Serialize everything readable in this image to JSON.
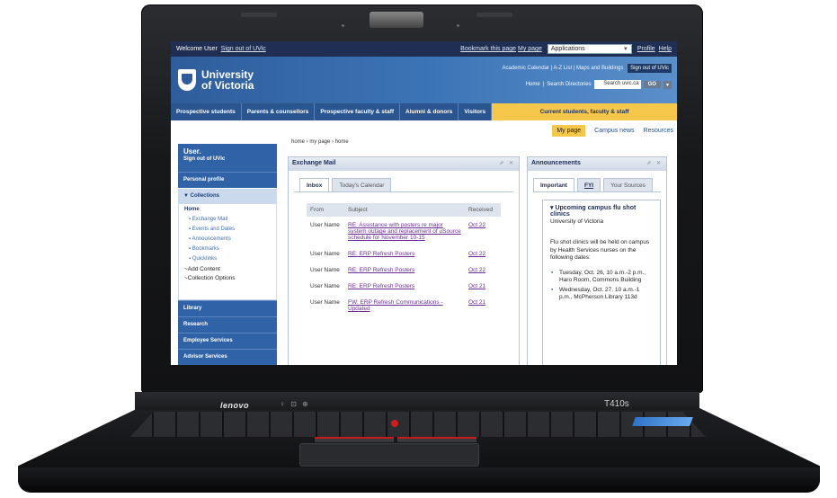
{
  "colors": {
    "topbar": "#1f2e52",
    "brand": "#3b74b6",
    "nav_active": "#f5c84c",
    "sidebar": "#2f62a6",
    "link_visited": "#6a2d96"
  },
  "laptop": {
    "brand": "lenovo",
    "model": "T410s",
    "indicators": "♀ ⊡ ⊕"
  },
  "topbar": {
    "welcome": "Welcome User",
    "signout": "Sign out of UVic",
    "bookmark": "Bookmark this page",
    "mypage": "My page",
    "apps_value": "Applications",
    "profile": "Profile",
    "help": "Help"
  },
  "brand": {
    "line1": "University",
    "line2": "of Victoria",
    "links": "Academic Calendar | A-Z List | Maps and Buildings",
    "signout_btn": "Sign out of UVic",
    "home": "Home",
    "search_dir": "Search Directories",
    "search_placeholder": "Search uvic.ca",
    "go": "GO",
    "dd": "▾"
  },
  "nav": [
    "Prospective students",
    "Parents & counsellors",
    "Prospective faculty & staff",
    "Alumni & donors",
    "Visitors",
    "Current students, faculty & staff"
  ],
  "subnav": {
    "mypage": "My page",
    "news": "Campus news",
    "resources": "Resources"
  },
  "breadcrumb": "home  ›  my page  ›  home",
  "sidebar": {
    "user": "User.",
    "signout": "Sign out of UVic",
    "profile": "Personal profile",
    "collections": "▼ Collections",
    "home": "Home",
    "items": [
      "Exchange Mail",
      "Events and Dates",
      "Announcements",
      "Bookmarks",
      "Quicklinks"
    ],
    "add": "~Add Content",
    "options": "~Collection Options",
    "bottom": [
      "Library",
      "Research",
      "Employee Services",
      "Advisor Services"
    ]
  },
  "mail": {
    "title": "Exchange Mail",
    "controls": "⇗ ✕",
    "tabs": [
      "Inbox",
      "Today's Calendar"
    ],
    "columns": [
      "From",
      "Subject",
      "Received"
    ],
    "rows": [
      {
        "from": "User Name",
        "subject": "RE: Assistance with posters re major system outage and replacement of uSource schedule for November 10-15",
        "received": "Oct 22"
      },
      {
        "from": "User Name",
        "subject": "RE: ERP Refresh Posters",
        "received": "Oct 22"
      },
      {
        "from": "User Name",
        "subject": "RE: ERP Refresh Posters",
        "received": "Oct 22"
      },
      {
        "from": "User Name",
        "subject": "RE: ERP Refresh Posters",
        "received": "Oct 21"
      },
      {
        "from": "User Name",
        "subject": "FW: ERP Refresh Communications - Updated",
        "received": "Oct 21"
      }
    ]
  },
  "announcements": {
    "title": "Announcements",
    "controls": "⇗ ✕",
    "tabs": [
      "Important",
      "FYI",
      "Your Sources"
    ],
    "item_title": "▾ Upcoming campus flu shot clinics",
    "item_source": "University of Victoria",
    "body": "Flu shot clinics will be held on campus by Health Services nurses on the following dates:",
    "dates": [
      "Tuesday, Oct. 26, 10 a.m.-2 p.m., Haro Room, Commons Building",
      "Wednesday, Oct. 27, 10 a.m.-1 p.m., McPherson Library 113d"
    ]
  }
}
